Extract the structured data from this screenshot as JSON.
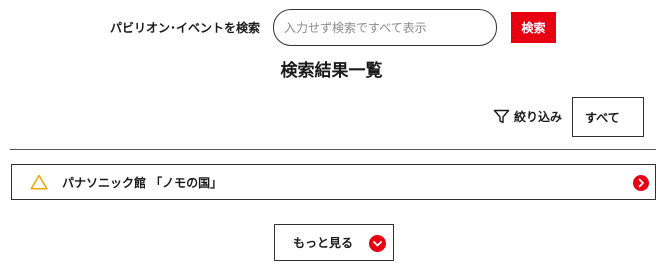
{
  "search": {
    "label": "パビリオン･イベントを検索",
    "placeholder": "入力せず検索ですべて表示",
    "value": "",
    "button_label": "検索"
  },
  "results": {
    "title": "検索結果一覧",
    "filter": {
      "icon": "filter-icon",
      "label": "絞り込み",
      "selected": "すべて"
    },
    "items": [
      {
        "icon": "triangle-icon",
        "icon_color": "#f0a500",
        "title": "パナソニック館 「ノモの国」",
        "arrow_icon": "chevron-right-circle-icon"
      }
    ],
    "more_button": {
      "label": "もっと見る",
      "icon": "chevron-down-circle-icon"
    }
  },
  "colors": {
    "accent": "#e60012",
    "text": "#1a1a1a",
    "border": "#333333",
    "triangle": "#f0a500"
  }
}
